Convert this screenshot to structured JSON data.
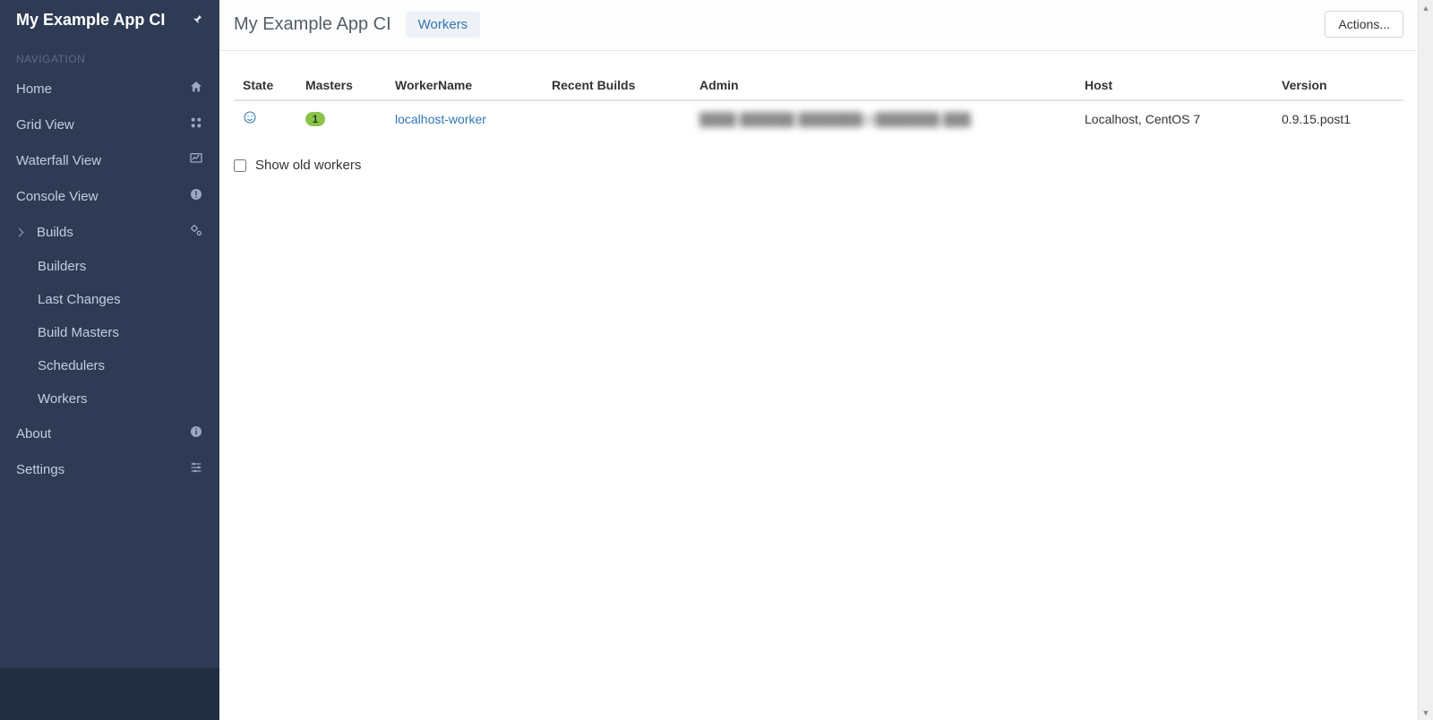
{
  "app": {
    "title": "My Example App CI"
  },
  "sidebar": {
    "section_label": "NAVIGATION",
    "items": [
      {
        "key": "home",
        "label": "Home",
        "icon": "home-icon"
      },
      {
        "key": "grid",
        "label": "Grid View",
        "icon": "grid-icon"
      },
      {
        "key": "waterfall",
        "label": "Waterfall View",
        "icon": "chart-icon"
      },
      {
        "key": "console",
        "label": "Console View",
        "icon": "alert-icon"
      },
      {
        "key": "builds",
        "label": "Builds",
        "icon": "gears-icon",
        "expanded": true,
        "children": [
          {
            "key": "builders",
            "label": "Builders"
          },
          {
            "key": "lastchanges",
            "label": "Last Changes"
          },
          {
            "key": "buildmasters",
            "label": "Build Masters"
          },
          {
            "key": "schedulers",
            "label": "Schedulers"
          },
          {
            "key": "workers",
            "label": "Workers"
          }
        ]
      },
      {
        "key": "about",
        "label": "About",
        "icon": "info-icon"
      },
      {
        "key": "settings",
        "label": "Settings",
        "icon": "sliders-icon"
      }
    ]
  },
  "header": {
    "title": "My Example App CI",
    "active_tab": "Workers",
    "actions_label": "Actions..."
  },
  "table": {
    "columns": {
      "state": "State",
      "masters": "Masters",
      "workername": "WorkerName",
      "recentbuilds": "Recent Builds",
      "admin": "Admin",
      "host": "Host",
      "version": "Version"
    },
    "rows": [
      {
        "state": "connected",
        "masters": "1",
        "workername": "localhost-worker",
        "recentbuilds": "",
        "admin": "████ ██████  ███████@███████.███",
        "host": "Localhost, CentOS 7",
        "version": "0.9.15.post1"
      }
    ]
  },
  "show_old": {
    "label": "Show old workers",
    "checked": false
  }
}
